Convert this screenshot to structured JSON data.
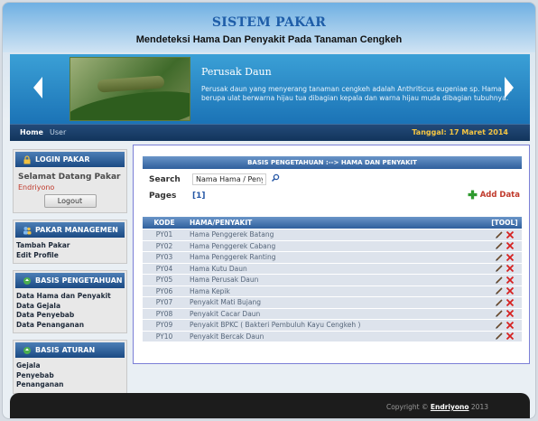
{
  "header": {
    "title": "SISTEM PAKAR",
    "subtitle": "Mendeteksi Hama Dan Penyakit Pada Tanaman Cengkeh"
  },
  "slider": {
    "title": "Perusak Daun",
    "text": "Perusak daun yang menyerang tanaman cengkeh adalah Anthriticus eugeniae sp. Hama ini berupa ulat berwarna hijau tua dibagian kepala dan warna hijau muda dibagian tubuhnya."
  },
  "nav": {
    "items": [
      "Home",
      "User"
    ],
    "date": "Tanggal: 17 Maret 2014"
  },
  "sidebar": {
    "login": {
      "heading": "LOGIN PAKAR",
      "welcome": "Selamat Datang Pakar",
      "username": "Endriyono",
      "logout_label": "Logout"
    },
    "pakar": {
      "heading": "PAKAR MANAGEMEN",
      "links": [
        "Tambah Pakar",
        "Edit Profile"
      ]
    },
    "basis_pengetahuan": {
      "heading": "BASIS PENGETAHUAN",
      "links": [
        "Data Hama dan Penyakit",
        "Data Gejala",
        "Data Penyebab",
        "Data Penanganan"
      ]
    },
    "basis_aturan": {
      "heading": "BASIS ATURAN",
      "links": [
        "Gejala",
        "Penyebab",
        "Penanganan"
      ]
    }
  },
  "main": {
    "section_title": "BASIS PENGETAHUAN :--> HAMA DAN PENYAKIT",
    "search_label": "Search",
    "search_value": "Nama Hama / Penyakit",
    "pages_label": "Pages",
    "pages_value": "[1]",
    "add_label": "Add Data",
    "table": {
      "headers": [
        "KODE",
        "HAMA/PENYAKIT",
        "[TOOL]"
      ],
      "rows": [
        {
          "kode": "PY01",
          "nama": "Hama Penggerek Batang"
        },
        {
          "kode": "PY02",
          "nama": "Hama Penggerek Cabang"
        },
        {
          "kode": "PY03",
          "nama": "Hama Penggerek Ranting"
        },
        {
          "kode": "PY04",
          "nama": "Hama Kutu Daun"
        },
        {
          "kode": "PY05",
          "nama": "Hama Perusak Daun"
        },
        {
          "kode": "PY06",
          "nama": "Hama Kepik"
        },
        {
          "kode": "PY07",
          "nama": "Penyakit Mati Bujang"
        },
        {
          "kode": "PY08",
          "nama": "Penyakit Cacar Daun"
        },
        {
          "kode": "PY09",
          "nama": "Penyakit BPKC ( Bakteri Pembuluh Kayu Cengkeh )"
        },
        {
          "kode": "PY10",
          "nama": "Penyakit Bercak Daun"
        }
      ]
    }
  },
  "footer": {
    "prefix": "Copyright ©",
    "owner": "Endriyono",
    "year": "2013"
  },
  "colors": {
    "header_blue": "#1e5da8",
    "nav_date": "#f5c542",
    "panel_head": "#1b4a83",
    "delete_red": "#d62020",
    "add_green": "#2e9a2e"
  }
}
